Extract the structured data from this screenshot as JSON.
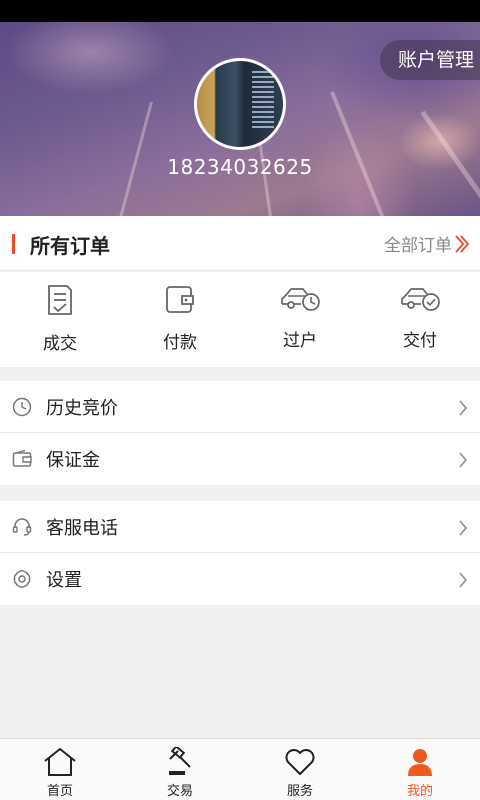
{
  "header": {
    "account_button": "账户管理",
    "phone": "18234032625"
  },
  "orders": {
    "title": "所有订单",
    "all_link": "全部订单",
    "items": [
      {
        "label": "成交",
        "icon": "deal-document-icon"
      },
      {
        "label": "付款",
        "icon": "wallet-icon"
      },
      {
        "label": "过户",
        "icon": "car-clock-icon"
      },
      {
        "label": "交付",
        "icon": "car-check-icon"
      }
    ]
  },
  "menu": {
    "group1": [
      {
        "label": "历史竞价",
        "icon": "clock-icon"
      },
      {
        "label": "保证金",
        "icon": "wallet-icon"
      }
    ],
    "group2": [
      {
        "label": "客服电话",
        "icon": "headset-icon"
      },
      {
        "label": "设置",
        "icon": "gear-icon"
      }
    ]
  },
  "tabbar": {
    "items": [
      {
        "label": "首页",
        "icon": "home-icon"
      },
      {
        "label": "交易",
        "icon": "gavel-icon"
      },
      {
        "label": "服务",
        "icon": "heart-icon"
      },
      {
        "label": "我的",
        "icon": "person-icon",
        "active": true
      }
    ],
    "active_color": "#ec5a1c"
  },
  "colors": {
    "accent": "#f24a23",
    "background": "#efefef"
  }
}
